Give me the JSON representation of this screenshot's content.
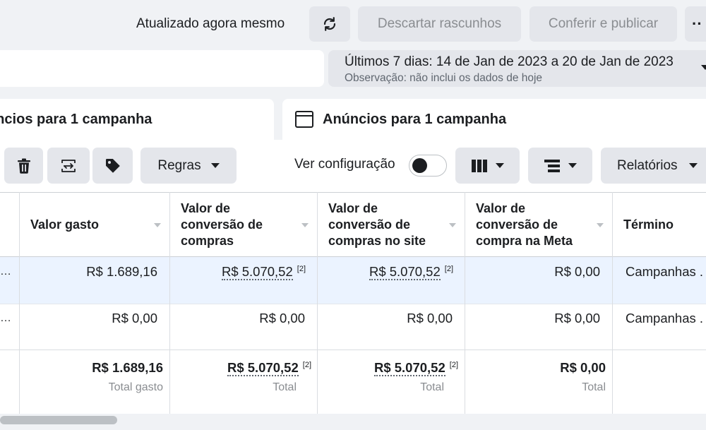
{
  "header": {
    "status": "Atualizado agora mesmo",
    "refresh_icon": "refresh-icon",
    "discard_label": "Descartar rascunhos",
    "publish_label": "Conferir e publicar",
    "more_label": "··"
  },
  "date_filter": {
    "range": "Últimos 7 dias: 14 de Jan de 2023 a 20 de Jan de 2023",
    "note": "Observação: não inclui os dados de hoje"
  },
  "tabs": [
    {
      "label": "úncios para 1 campanha"
    },
    {
      "label": "Anúncios para 1 campanha"
    }
  ],
  "toolbar": {
    "rules_label": "Regras",
    "view_config_label": "Ver configuração",
    "view_config_on": false,
    "reports_label": "Relatórios"
  },
  "table": {
    "headers": [
      "Valor gasto",
      "Valor de conversão de compras",
      "Valor de conversão de compras no site",
      "Valor de conversão de compra na Meta",
      "Término"
    ],
    "rows": [
      {
        "ellipsis": "…",
        "spend": "R$ 1.689,16",
        "conv_purchases": "R$ 5.070,52",
        "conv_purchases_note": "[2]",
        "conv_site": "R$ 5.070,52",
        "conv_site_note": "[2]",
        "conv_meta": "R$ 0,00",
        "end": "Campanhas ."
      },
      {
        "ellipsis": "…",
        "spend": "R$ 0,00",
        "conv_purchases": "R$ 0,00",
        "conv_site": "R$ 0,00",
        "conv_meta": "R$ 0,00",
        "end": "Campanhas ."
      }
    ],
    "totals": {
      "spend": "R$ 1.689,16",
      "spend_label": "Total gasto",
      "conv_purchases": "R$ 5.070,52",
      "conv_purchases_note": "[2]",
      "conv_purchases_label": "Total",
      "conv_site": "R$ 5.070,52",
      "conv_site_note": "[2]",
      "conv_site_label": "Total",
      "conv_meta": "R$ 0,00",
      "conv_meta_label": "Total"
    }
  }
}
